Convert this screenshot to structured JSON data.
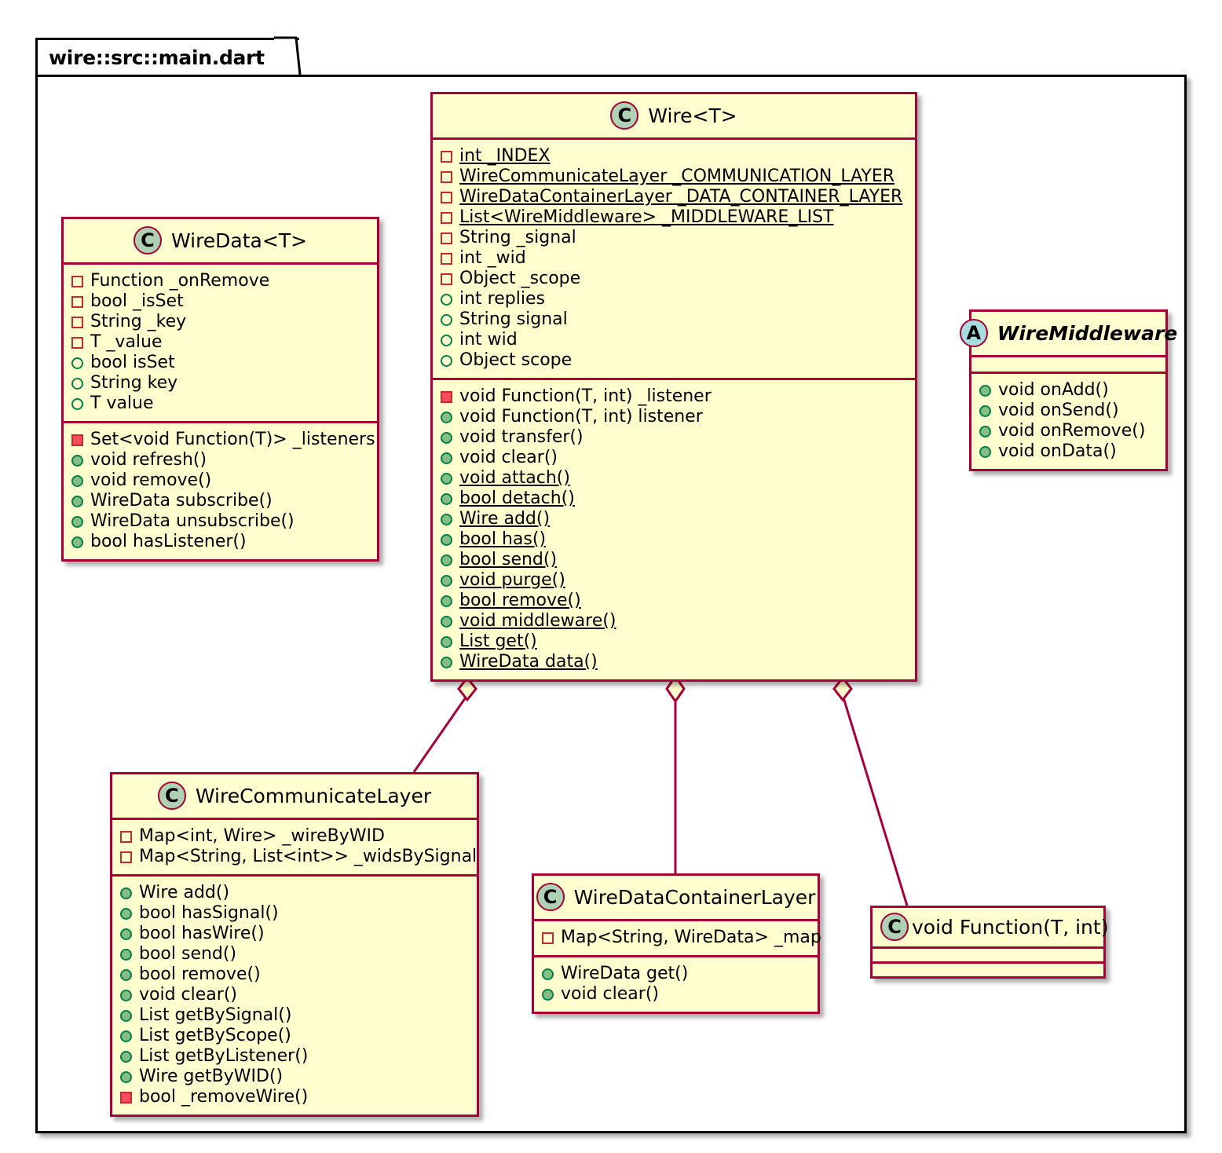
{
  "package": {
    "label": "wire::src::main.dart"
  },
  "colors": {
    "body_fill": "#FEFECE",
    "border": "#A80036",
    "class_badge": "#ADD1B2",
    "abstract_badge": "#A9DCDF",
    "private_marker": "#C82930",
    "public_marker": "#038048",
    "private_method_fill": "#F24D5C",
    "public_method_fill": "#84BE84",
    "frame_border": "#000000",
    "page_background": "#FFFFFF"
  },
  "classes": [
    {
      "id": "wire",
      "name": "Wire<T>",
      "stereotype": "C",
      "abstract": false,
      "fields": [
        {
          "visibility": "private",
          "static": true,
          "text": "int _INDEX"
        },
        {
          "visibility": "private",
          "static": true,
          "text": "WireCommunicateLayer _COMMUNICATION_LAYER"
        },
        {
          "visibility": "private",
          "static": true,
          "text": "WireDataContainerLayer _DATA_CONTAINER_LAYER"
        },
        {
          "visibility": "private",
          "static": true,
          "text": "List<WireMiddleware> _MIDDLEWARE_LIST"
        },
        {
          "visibility": "private",
          "static": false,
          "text": "String _signal"
        },
        {
          "visibility": "private",
          "static": false,
          "text": "int _wid"
        },
        {
          "visibility": "private",
          "static": false,
          "text": "Object _scope"
        },
        {
          "visibility": "public",
          "static": false,
          "text": "int replies"
        },
        {
          "visibility": "public",
          "static": false,
          "text": "String signal"
        },
        {
          "visibility": "public",
          "static": false,
          "text": "int wid"
        },
        {
          "visibility": "public",
          "static": false,
          "text": "Object scope"
        }
      ],
      "methods": [
        {
          "visibility": "private",
          "static": false,
          "text": "void Function(T, int) _listener"
        },
        {
          "visibility": "public",
          "static": false,
          "text": "void Function(T, int) listener"
        },
        {
          "visibility": "public",
          "static": false,
          "text": "void transfer()"
        },
        {
          "visibility": "public",
          "static": false,
          "text": "void clear()"
        },
        {
          "visibility": "public",
          "static": true,
          "text": "void attach()"
        },
        {
          "visibility": "public",
          "static": true,
          "text": "bool detach()"
        },
        {
          "visibility": "public",
          "static": true,
          "text": "Wire add()"
        },
        {
          "visibility": "public",
          "static": true,
          "text": "bool has()"
        },
        {
          "visibility": "public",
          "static": true,
          "text": "bool send()"
        },
        {
          "visibility": "public",
          "static": true,
          "text": "void purge()"
        },
        {
          "visibility": "public",
          "static": true,
          "text": "bool remove()"
        },
        {
          "visibility": "public",
          "static": true,
          "text": "void middleware()"
        },
        {
          "visibility": "public",
          "static": true,
          "text": "List get()"
        },
        {
          "visibility": "public",
          "static": true,
          "text": "WireData data()"
        }
      ]
    },
    {
      "id": "wiredata",
      "name": "WireData<T>",
      "stereotype": "C",
      "abstract": false,
      "fields": [
        {
          "visibility": "private",
          "static": false,
          "text": "Function _onRemove"
        },
        {
          "visibility": "private",
          "static": false,
          "text": "bool _isSet"
        },
        {
          "visibility": "private",
          "static": false,
          "text": "String _key"
        },
        {
          "visibility": "private",
          "static": false,
          "text": "T _value"
        },
        {
          "visibility": "public",
          "static": false,
          "text": "bool isSet"
        },
        {
          "visibility": "public",
          "static": false,
          "text": "String key"
        },
        {
          "visibility": "public",
          "static": false,
          "text": "T value"
        }
      ],
      "methods": [
        {
          "visibility": "private",
          "static": false,
          "text": "Set<void Function(T)> _listeners"
        },
        {
          "visibility": "public",
          "static": false,
          "text": "void refresh()"
        },
        {
          "visibility": "public",
          "static": false,
          "text": "void remove()"
        },
        {
          "visibility": "public",
          "static": false,
          "text": "WireData subscribe()"
        },
        {
          "visibility": "public",
          "static": false,
          "text": "WireData unsubscribe()"
        },
        {
          "visibility": "public",
          "static": false,
          "text": "bool hasListener()"
        }
      ]
    },
    {
      "id": "wiremiddleware",
      "name": "WireMiddleware",
      "stereotype": "A",
      "abstract": true,
      "fields": [],
      "methods": [
        {
          "visibility": "public",
          "static": false,
          "text": "void onAdd()"
        },
        {
          "visibility": "public",
          "static": false,
          "text": "void onSend()"
        },
        {
          "visibility": "public",
          "static": false,
          "text": "void onRemove()"
        },
        {
          "visibility": "public",
          "static": false,
          "text": "void onData()"
        }
      ]
    },
    {
      "id": "wirecommunicatelayer",
      "name": "WireCommunicateLayer",
      "stereotype": "C",
      "abstract": false,
      "fields": [
        {
          "visibility": "private",
          "static": false,
          "text": "Map<int, Wire> _wireByWID"
        },
        {
          "visibility": "private",
          "static": false,
          "text": "Map<String, List<int>> _widsBySignal"
        }
      ],
      "methods": [
        {
          "visibility": "public",
          "static": false,
          "text": "Wire add()"
        },
        {
          "visibility": "public",
          "static": false,
          "text": "bool hasSignal()"
        },
        {
          "visibility": "public",
          "static": false,
          "text": "bool hasWire()"
        },
        {
          "visibility": "public",
          "static": false,
          "text": "bool send()"
        },
        {
          "visibility": "public",
          "static": false,
          "text": "bool remove()"
        },
        {
          "visibility": "public",
          "static": false,
          "text": "void clear()"
        },
        {
          "visibility": "public",
          "static": false,
          "text": "List getBySignal()"
        },
        {
          "visibility": "public",
          "static": false,
          "text": "List getByScope()"
        },
        {
          "visibility": "public",
          "static": false,
          "text": "List getByListener()"
        },
        {
          "visibility": "public",
          "static": false,
          "text": "Wire getByWID()"
        },
        {
          "visibility": "private",
          "static": false,
          "text": "bool _removeWire()"
        }
      ]
    },
    {
      "id": "wiredatacontainerlayer",
      "name": "WireDataContainerLayer",
      "stereotype": "C",
      "abstract": false,
      "fields": [
        {
          "visibility": "private",
          "static": false,
          "text": "Map<String, WireData> _map"
        }
      ],
      "methods": [
        {
          "visibility": "public",
          "static": false,
          "text": "WireData get()"
        },
        {
          "visibility": "public",
          "static": false,
          "text": "void clear()"
        }
      ]
    },
    {
      "id": "voidfunction",
      "name": "void Function(T, int)",
      "stereotype": "C",
      "abstract": false,
      "fields": [],
      "methods": []
    }
  ],
  "relations": [
    {
      "from": "wire",
      "to": "wirecommunicatelayer",
      "type": "aggregation"
    },
    {
      "from": "wire",
      "to": "wiredatacontainerlayer",
      "type": "aggregation"
    },
    {
      "from": "wire",
      "to": "voidfunction",
      "type": "aggregation"
    }
  ]
}
